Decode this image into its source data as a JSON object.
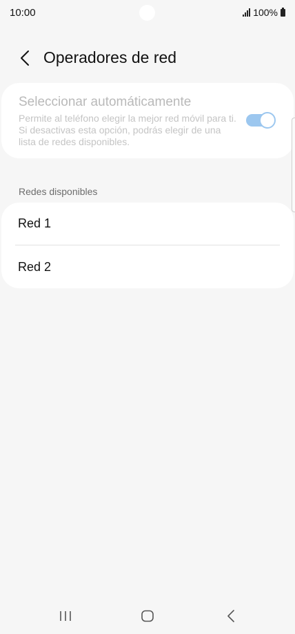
{
  "status_bar": {
    "time": "10:00",
    "battery_text": "100%"
  },
  "header": {
    "title": "Operadores de red",
    "back_icon": "chevron-left-icon"
  },
  "auto_select": {
    "title": "Seleccionar automáticamente",
    "description": "Permite al teléfono elegir la mejor red móvil para ti. Si desactivas esta opción, podrás elegir de una lista de redes disponibles.",
    "toggle_on": true,
    "accent_color": "#9cc7ef"
  },
  "networks": {
    "section_label": "Redes disponibles",
    "items": [
      {
        "label": "Red 1"
      },
      {
        "label": "Red 2"
      }
    ]
  },
  "nav_bar": {
    "recent_icon": "recent-apps-icon",
    "home_icon": "home-icon",
    "back_icon": "back-icon"
  }
}
